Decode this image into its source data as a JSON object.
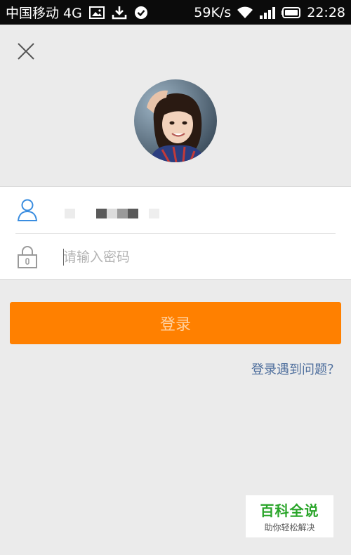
{
  "status_bar": {
    "carrier": "中国移动 4G",
    "speed": "59K/s",
    "time": "22:28",
    "icons": [
      "image-icon",
      "download-icon",
      "check-circle-icon",
      "wifi-icon",
      "signal-icon",
      "battery-icon"
    ]
  },
  "login": {
    "close_icon": "close-icon",
    "user_icon": "user-icon",
    "lock_icon": "lock-icon",
    "password_placeholder": "请输入密码",
    "login_button": "登录",
    "help_link": "登录遇到问题？"
  },
  "watermark": {
    "title": "百科全说",
    "subtitle": "助你轻松解决"
  },
  "colors": {
    "accent": "#ff8000",
    "link": "#4f6f9d",
    "icon_blue": "#3a8de0"
  }
}
